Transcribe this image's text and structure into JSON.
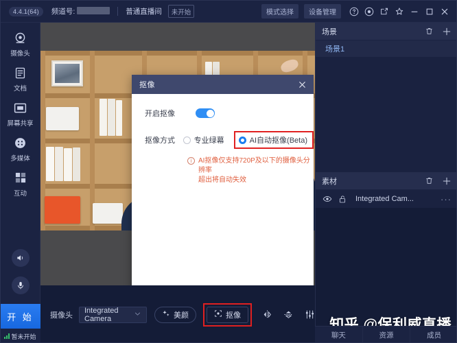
{
  "titlebar": {
    "version": "4.4.1(64)",
    "channel_label": "频道号:",
    "channel_value_masked": "",
    "room_type": "普通直播间",
    "status": "未开始",
    "mode_button": "模式选择",
    "device_button": "设备管理",
    "icons": [
      "help-icon",
      "record-icon",
      "popout-icon",
      "pin-icon",
      "minimize-icon",
      "maximize-icon",
      "close-icon"
    ]
  },
  "sidebar": {
    "items": [
      {
        "label": "摄像头",
        "icon": "camera-icon"
      },
      {
        "label": "文档",
        "icon": "document-icon"
      },
      {
        "label": "屏幕共享",
        "icon": "screen-share-icon"
      },
      {
        "label": "多媒体",
        "icon": "multimedia-icon"
      },
      {
        "label": "互动",
        "icon": "interactive-icon"
      }
    ],
    "speaker_icon": "speaker-icon",
    "mic_icon": "microphone-icon",
    "start_button": "开 始",
    "foot_status": "暂未开始"
  },
  "dialog": {
    "title": "抠像",
    "close": "×",
    "enable_label": "开启抠像",
    "enable_on": true,
    "method_label": "抠像方式",
    "options": [
      {
        "label": "专业绿幕",
        "selected": false
      },
      {
        "label": "AI自动抠像(Beta)",
        "selected": true
      }
    ],
    "warning_line1": "AI抠像仅支持720P及以下的摄像头分辨率",
    "warning_line2": "超出将自动失效"
  },
  "right": {
    "scene_panel": {
      "title": "场景",
      "delete_icon": "trash-icon",
      "add_icon": "plus-icon",
      "items": [
        "场景1"
      ]
    },
    "material_panel": {
      "title": "素材",
      "delete_icon": "trash-icon",
      "add_icon": "plus-icon",
      "items": [
        {
          "name": "Integrated Cam...",
          "visible_icon": "eye-icon",
          "lock_icon": "unlock-icon",
          "more": "···"
        }
      ]
    }
  },
  "bottombar": {
    "camera_label": "摄像头",
    "camera_value": "Integrated Camera",
    "chevron": "▾",
    "beauty_button": "美颜",
    "keying_button": "抠像",
    "tools": [
      "mirror-horizontal-icon",
      "flip-vertical-icon",
      "adjust-sliders-icon"
    ]
  },
  "watermark": "知乎 @保利威直播",
  "tabs": [
    "聊天",
    "资源",
    "成员"
  ],
  "colors": {
    "accent_blue": "#2f8ef4",
    "highlight_red": "#e02020",
    "panel_dark": "#1b2342",
    "bg_dark": "#141c37",
    "warning_orange": "#e06040"
  }
}
